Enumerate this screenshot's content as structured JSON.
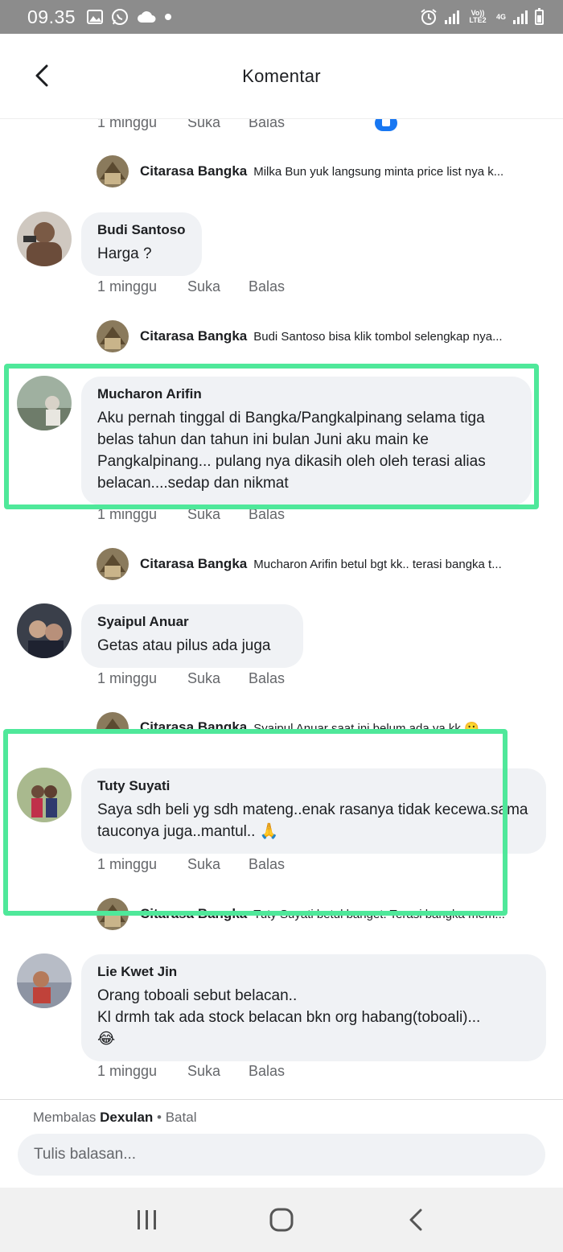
{
  "status_bar": {
    "time": "09.35",
    "network_label_top": "Vo)) LTE2",
    "network_4g": "4G"
  },
  "header": {
    "title": "Komentar"
  },
  "comments_actions": {
    "time": "1 minggu",
    "like": "Suka",
    "reply": "Balas"
  },
  "comments": [
    {
      "name": "Budi Santoso",
      "text": "Harga ?",
      "reply_from": "Citarasa Bangka",
      "reply_text": "Budi Santoso bisa klik tombol selengkap nya..."
    },
    {
      "name": "Mucharon Arifin",
      "text": "Aku pernah tinggal di Bangka/Pangkalpinang selama tiga belas tahun dan tahun ini bulan Juni aku main ke Pangkalpinang... pulang nya dikasih oleh oleh terasi alias belacan....sedap dan nikmat",
      "reply_from": "Citarasa Bangka",
      "reply_text": "Mucharon Arifin betul bgt kk.. terasi bangka t..."
    },
    {
      "name": "Syaipul Anuar",
      "text": "Getas atau pilus ada juga",
      "reply_from": "Citarasa Bangka",
      "reply_text": "Syaipul Anuar saat ini belum ada ya kk 🙂"
    },
    {
      "name": "Tuty Suyati",
      "text": "Saya sdh beli yg sdh mateng..enak rasanya tidak kecewa.sama tauconya juga..mantul.. 🙏",
      "reply_from": "Citarasa Bangka",
      "reply_text": "Tuty Suyati betul banget. Terasi bangka mem..."
    },
    {
      "name": "Lie Kwet Jin",
      "text": "Orang toboali sebut belacan..\nKl drmh tak ada stock belacan bkn org habang(toboali)...\n😂"
    }
  ],
  "top_reply": {
    "from": "Citarasa Bangka",
    "text": "Milka Bun yuk langsung minta price list nya k..."
  },
  "composer": {
    "reply_prefix": "Membalas",
    "reply_to_name": "Dexulan",
    "separator": "•",
    "cancel": "Batal",
    "placeholder": "Tulis balasan..."
  },
  "colors": {
    "highlight": "#4fe89a",
    "bubble": "#f0f2f5",
    "status_bar": "#8c8c8c"
  }
}
